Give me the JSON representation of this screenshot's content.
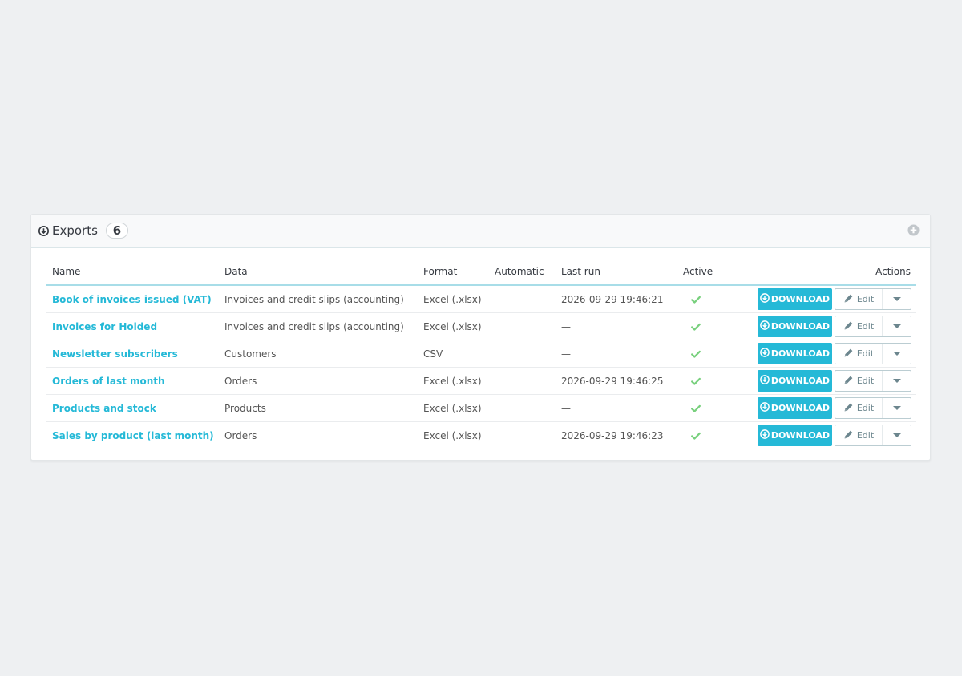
{
  "panel": {
    "title": "Exports",
    "count": "6"
  },
  "table": {
    "headers": {
      "name": "Name",
      "data": "Data",
      "format": "Format",
      "automatic": "Automatic",
      "last_run": "Last run",
      "active": "Active",
      "actions": "Actions"
    },
    "rows": [
      {
        "name": "Book of invoices issued (VAT)",
        "data": "Invoices and credit slips (accounting)",
        "format": "Excel (.xlsx)",
        "automatic": "",
        "last_run": "2026-09-29 19:46:21",
        "active": true
      },
      {
        "name": "Invoices for Holded",
        "data": "Invoices and credit slips (accounting)",
        "format": "Excel (.xlsx)",
        "automatic": "",
        "last_run": "—",
        "active": true
      },
      {
        "name": "Newsletter subscribers",
        "data": "Customers",
        "format": "CSV",
        "automatic": "",
        "last_run": "—",
        "active": true
      },
      {
        "name": "Orders of last month",
        "data": "Orders",
        "format": "Excel (.xlsx)",
        "automatic": "",
        "last_run": "2026-09-29 19:46:25",
        "active": true
      },
      {
        "name": "Products and stock",
        "data": "Products",
        "format": "Excel (.xlsx)",
        "automatic": "",
        "last_run": "—",
        "active": true
      },
      {
        "name": "Sales by product (last month)",
        "data": "Orders",
        "format": "Excel (.xlsx)",
        "automatic": "",
        "last_run": "2026-09-29 19:46:23",
        "active": true
      }
    ],
    "actions": {
      "download_label": "DOWNLOAD",
      "edit_label": "Edit"
    }
  },
  "icons": {
    "title": "download-circle-icon",
    "add": "plus-circle-icon",
    "active": "check-icon",
    "download": "download-circle-icon",
    "edit": "pencil-icon",
    "dropdown": "caret-down-icon"
  },
  "colors": {
    "accent": "#25b9d7",
    "check": "#78d07d",
    "page_bg": "#eef0f2"
  }
}
